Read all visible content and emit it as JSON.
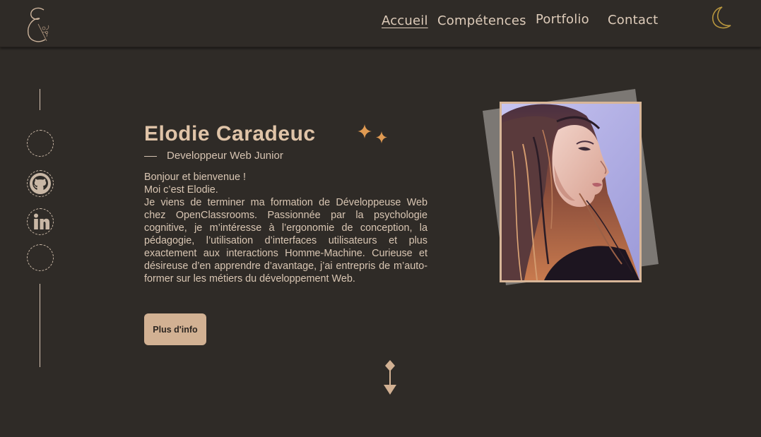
{
  "header": {
    "logo_icon": "cursive-e-floral-logo",
    "nav": {
      "home": "Accueil",
      "skills": "Compétences",
      "portfolio": "Portfolio",
      "contact": "Contact"
    },
    "theme_toggle_icon": "moon-icon"
  },
  "social": {
    "items": [
      "empty-circle",
      "github-icon",
      "linkedin-icon",
      "empty-circle"
    ]
  },
  "intro": {
    "name": "Elodie Caradeuc",
    "role": "Developpeur Web Junior",
    "greeting": "Bonjour et bienvenue !",
    "line2": "Moi c’est Elodie.",
    "paragraph": "Je viens de terminer ma formation de Développeuse Web chez OpenClassrooms. Passionnée par la psychologie cognitive, je m’intéresse à l’ergonomie de conception, la pédagogie, l’utilisation d’interfaces utilisateurs et plus exactement aux interactions Homme-Machine. Curieuse et désireuse d’en apprendre d’avantage, j’ai entrepris de m’auto-former sur les métiers du développement Web.",
    "button_label": "Plus d'info"
  },
  "colors": {
    "background": "#2f2b27",
    "accent": "#d2b193",
    "sparkle": "#e09a52",
    "moon": "#b8963e"
  }
}
